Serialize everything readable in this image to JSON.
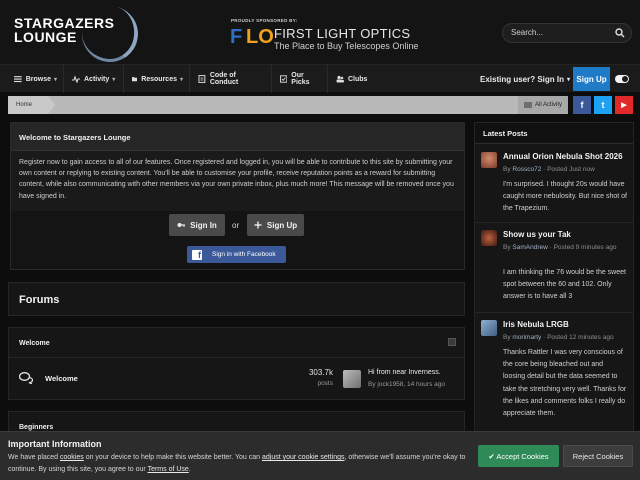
{
  "site": {
    "logo_text_line1": "STARGAZERS",
    "logo_text_line2": "LOUNGE"
  },
  "sponsor": {
    "label": "PROUDLY SPONSORED BY:",
    "mark_f": "F",
    "mark_o": "LO",
    "title": "FIRST LIGHT OPTICS",
    "subtitle": "The Place to Buy Telescopes Online"
  },
  "search": {
    "placeholder": "Search..."
  },
  "nav": {
    "items": [
      {
        "label": "Browse",
        "icon": "menu-icon",
        "caret": "▾"
      },
      {
        "label": "Activity",
        "icon": "activity-icon",
        "caret": "▾"
      },
      {
        "label": "Resources",
        "icon": "folder-icon",
        "caret": "▾"
      },
      {
        "label": "Code of Conduct",
        "icon": "document-icon",
        "caret": ""
      },
      {
        "label": "Our Picks",
        "icon": "check-icon",
        "caret": ""
      },
      {
        "label": "Clubs",
        "icon": "users-icon",
        "caret": ""
      }
    ],
    "existing_user": "Existing user? Sign In",
    "existing_caret": "▾",
    "sign_up": "Sign Up"
  },
  "breadcrumb": {
    "home": "Home",
    "all_activity": "All Activity"
  },
  "social": {
    "facebook": "f",
    "twitter": "t",
    "youtube": "▶"
  },
  "welcome": {
    "title": "Welcome to Stargazers Lounge",
    "body": "Register now to gain access to all of our features. Once registered and logged in, you will be able to contribute to this site by submitting your own content or replying to existing content. You'll be able to customise your profile, receive reputation points as a reward for submitting content, while also communicating with other members via your own private inbox, plus much more! This message will be removed once you have signed in.",
    "sign_in": "Sign In",
    "or": "or",
    "sign_up": "Sign Up",
    "facebook": "Sign in with Facebook",
    "facebook_mark": "f"
  },
  "forums": {
    "title": "Forums",
    "categories": [
      {
        "name": "Welcome",
        "forum": {
          "name": "Welcome",
          "posts_count": "303.7k",
          "posts_label": "posts",
          "last_title": "Hi from near Inverness.",
          "last_meta": "By jock1958, 14 hours ago"
        }
      },
      {
        "name": "Beginners"
      }
    ]
  },
  "latest_posts": {
    "title": "Latest Posts",
    "items": [
      {
        "title": "Annual Orion Nebula Shot 2026",
        "by": "By ",
        "author": "Rossco72",
        "time": " · Posted Just now",
        "body": "I'm surprised. I thought 20s would have caught more nebulosity. But nice shot of the Trapezium."
      },
      {
        "title": "Show us your Tak",
        "by": "By ",
        "author": "SamAndrew",
        "time": " · Posted 9 minutes ago",
        "body": "I am thinking the 76 would be the sweet spot between the 60 and 102. Only answer is to have all 3"
      },
      {
        "title": "Iris Nebula LRGB",
        "by": "By ",
        "author": "morimarty",
        "time": " · Posted 12 minutes ago",
        "body": "Thanks Rattler I was very conscious of the core being bleached out and loosing detail but the data seemed to take the stretching very well. Thanks for the likes and comments folks I really do appreciate them."
      }
    ]
  },
  "cookie": {
    "title": "Important Information",
    "t1": "We have placed ",
    "l1": "cookies",
    "t2": " on your device to help make this website better. You can ",
    "l2": "adjust your cookie settings",
    "t3": ", otherwise we'll assume you're okay to continue. By using this site, you agree to our ",
    "l3": "Terms of Use",
    "t4": ".",
    "accept": "✔ Accept Cookies",
    "reject": "Reject Cookies"
  }
}
